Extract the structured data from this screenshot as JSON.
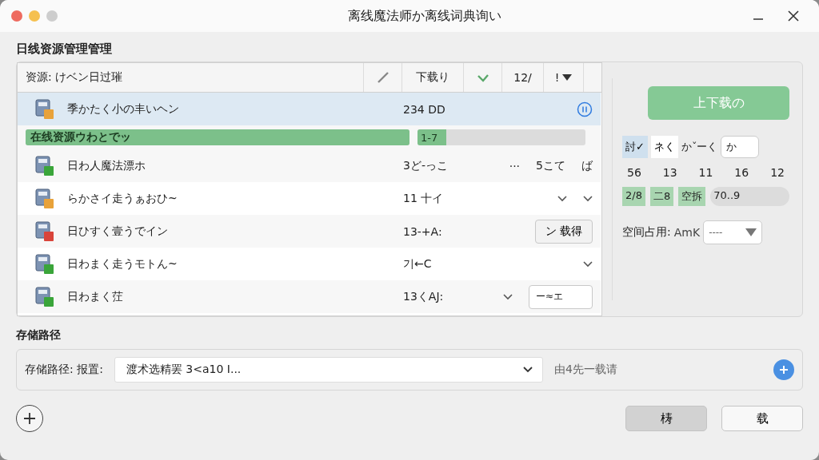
{
  "window": {
    "title": "离线魔法师か离线词典询い"
  },
  "group_title": "日线资源管理管理",
  "table": {
    "columns": [
      {
        "kind": "text",
        "label": "资源: けベン日过璀"
      },
      {
        "kind": "edit"
      },
      {
        "kind": "text",
        "label": "下载り"
      },
      {
        "kind": "check"
      },
      {
        "kind": "text",
        "label": "12/"
      },
      {
        "kind": "menu",
        "label": "!"
      }
    ],
    "rows": [
      {
        "kind": "file",
        "selected": true,
        "color": "#e8a23a",
        "name": "季かたく小の丰いヘン",
        "size": "234 DD",
        "controls": [
          {
            "kind": "pause"
          }
        ]
      },
      {
        "kind": "progress",
        "selected": false,
        "name": "在线资源ウわとでッ",
        "level": 1,
        "detail": {
          "text": "1-7",
          "level": 0.17
        }
      },
      {
        "kind": "file",
        "selected": false,
        "color": "#3aa53a",
        "name": "日わ人魔法漂ホ",
        "size": "3ど-っこ",
        "controls": [
          {
            "kind": "text",
            "text": "···"
          },
          {
            "kind": "text",
            "text": "5こて"
          },
          {
            "kind": "text",
            "text": "ば"
          }
        ]
      },
      {
        "kind": "file",
        "selected": false,
        "color": "#e8a23a",
        "name": "らかさイ走うぁおひ~",
        "size": "11 十イ",
        "controls": [
          {
            "kind": "chevron"
          },
          {
            "kind": "chevron"
          }
        ]
      },
      {
        "kind": "file",
        "selected": false,
        "color": "#d9443a",
        "name": "日ひすく壹うでイン",
        "size": "13-+A:",
        "controls": [
          {
            "kind": "button",
            "text": "ン 载得"
          }
        ]
      },
      {
        "kind": "file",
        "selected": false,
        "color": "#3aa53a",
        "name": "日わまく走うモトん~",
        "size": "기←C",
        "controls": [
          {
            "kind": "chevron"
          }
        ]
      },
      {
        "kind": "file",
        "selected": false,
        "color": "#3aa53a",
        "name": "日わまく茳",
        "size": "13くAJ:",
        "controls": [
          {
            "kind": "chevron"
          },
          {
            "kind": "field",
            "text": "ー≈エ"
          }
        ]
      }
    ]
  },
  "side": {
    "action": "上下载の",
    "segments": [
      {
        "label": "討✓",
        "selected": true
      },
      {
        "label": "ネく",
        "selected": false
      }
    ],
    "filter_label": "かˇーく",
    "filter_value": "か",
    "numbers": [
      "56",
      "13",
      "11",
      "16",
      "12"
    ],
    "tags": [
      {
        "label": "2/8",
        "color": "#a8d5b0"
      },
      {
        "label": "二8",
        "color": "#a8d5b0"
      },
      {
        "label": "空拆",
        "color": "#a8d5b0"
      },
      {
        "label": "70..9",
        "color": "#dcdcdc"
      }
    ],
    "space_label": "空间占用:",
    "space_value": "AmK",
    "space_select": "----"
  },
  "storage": {
    "heading": "存储路径",
    "label": "存储路径:  报置:",
    "path": "渡术选精罢  3<a10  I...",
    "hint": "由4先一载请"
  },
  "buttons": [
    {
      "label": "梼",
      "kind": "primary"
    },
    {
      "label": "载",
      "kind": "plain"
    }
  ]
}
